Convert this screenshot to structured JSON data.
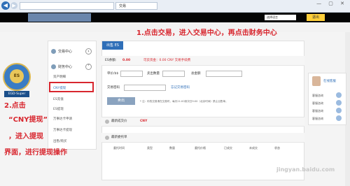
{
  "browser": {
    "back_label": "◀",
    "forward_label": "▶",
    "tab_title": "交易",
    "window_controls": "— ▢ ✕"
  },
  "topbar": {
    "select_value": "选择语言",
    "exit_label": "退出"
  },
  "annotations": {
    "step1": "1.点击交易，进入交易中心，再点击财务中心",
    "step2_line1": "2.点击",
    "step2_line2": "“CNY提现”",
    "step2_line3": "，进入提现",
    "step2_line4": "界面，进行提现操作"
  },
  "badge": {
    "inner_text": "ES",
    "label": "EGD-Super"
  },
  "sidebar": {
    "trade_center": "交易中心",
    "finance_center": "财务中心",
    "items": [
      "资产明细",
      "CNY提现",
      "ES充值",
      "ES提现",
      "万事达卡申请",
      "万事达卡提现",
      "出售/购买"
    ]
  },
  "main": {
    "active_tab": "出售 ES",
    "es_balance_label": "ES余额:",
    "es_balance_value": "0.00",
    "avail_text": "可卖资金：0.00 CNY 交易手续费",
    "price_label": "单价/$$",
    "qty_label": "卖出数量",
    "total_label": "总金额",
    "password_label": "交易密码",
    "forgot_link": "忘记交易密码",
    "submit_label": "卖出",
    "note": "* 注：你的交易请在交易时，每天21:00到次日9:00（北京时间）禁止出售单。",
    "sec2_title": "最新成交价",
    "sec2_value": "CNY",
    "sec3_title": "最新委托单",
    "table_headers": [
      "委托时间",
      "类型",
      "数量",
      "委托价格",
      "已成交",
      "未成交",
      "状态"
    ]
  },
  "right_panel": {
    "title": "在线客服",
    "items": [
      "客服咨询",
      "客服咨询",
      "客服咨询",
      "客服咨询"
    ]
  },
  "watermark": "jingyan.baidu.com"
}
